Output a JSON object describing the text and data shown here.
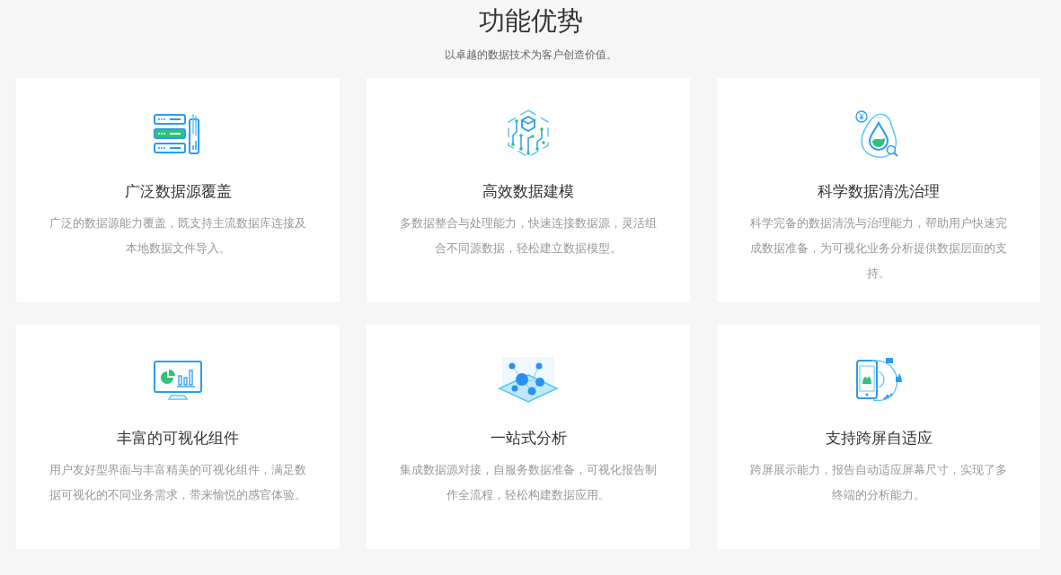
{
  "header": {
    "title": "功能优势",
    "subtitle": "以卓越的数据技术为客户创造价值。"
  },
  "features": [
    {
      "kind": "servers",
      "title": "广泛数据源覆盖",
      "description": "广泛的数据源能力覆盖，既支持主流数据库连接及本地数据文件导入。"
    },
    {
      "kind": "circuit",
      "title": "高效数据建模",
      "description": "多数据整合与处理能力，快速连接数据源，灵活组合不同源数据，轻松建立数据模型。"
    },
    {
      "kind": "drop",
      "title": "科学数据清洗治理",
      "description": "科学完备的数据清洗与治理能力，帮助用户快速完成数据准备，为可视化业务分析提供数据层面的支持。"
    },
    {
      "kind": "monitor",
      "title": "丰富的可视化组件",
      "description": "用户友好型界面与丰富精美的可视化组件，满足数据可视化的不同业务需求，带来愉悦的感官体验。"
    },
    {
      "kind": "network",
      "title": "一站式分析",
      "description": "集成数据源对接，自服务数据准备，可视化报告制作全流程，轻松构建数据应用。"
    },
    {
      "kind": "phone",
      "title": "支持跨屏自适应",
      "description": "跨屏展示能力，报告自动适应屏幕尺寸，实现了多终端的分析能力。"
    }
  ]
}
